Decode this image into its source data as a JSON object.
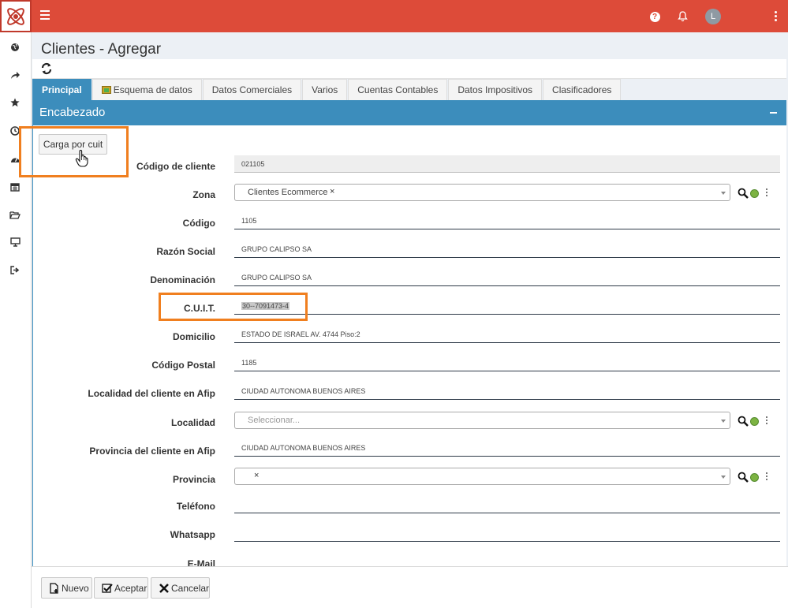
{
  "page": {
    "title": "Clientes - Agregar"
  },
  "tabs": [
    {
      "label": "Principal",
      "active": true
    },
    {
      "label": "Esquema de datos"
    },
    {
      "label": "Datos Comerciales"
    },
    {
      "label": "Varios"
    },
    {
      "label": "Cuentas Contables"
    },
    {
      "label": "Datos Impositivos"
    },
    {
      "label": "Clasificadores"
    }
  ],
  "panel": {
    "title": "Encabezado"
  },
  "actions": {
    "load_by_cuit": "Carga por cuit"
  },
  "form": {
    "codigo_cliente": {
      "label": "Código de cliente",
      "value": "021105"
    },
    "zona": {
      "label": "Zona",
      "value": "Clientes Ecommerce",
      "clear": "×"
    },
    "codigo": {
      "label": "Código",
      "value": "1105"
    },
    "razon_social": {
      "label": "Razón Social",
      "value": "GRUPO CALIPSO SA"
    },
    "denominacion": {
      "label": "Denominación",
      "value": "GRUPO CALIPSO SA"
    },
    "cuit": {
      "label": "C.U.I.T.",
      "value": "30--7091473-4"
    },
    "domicilio": {
      "label": "Domicilio",
      "value": "ESTADO DE ISRAEL AV. 4744 Piso:2"
    },
    "codigo_postal": {
      "label": "Código Postal",
      "value": "1185"
    },
    "localidad_afip": {
      "label": "Localidad del cliente en Afip",
      "value": "CIUDAD AUTONOMA BUENOS AIRES"
    },
    "localidad": {
      "label": "Localidad",
      "placeholder": "Seleccionar..."
    },
    "provincia_afip": {
      "label": "Provincia del cliente en Afip",
      "value": "CIUDAD AUTONOMA BUENOS AIRES"
    },
    "provincia": {
      "label": "Provincia",
      "value": "",
      "clear": "×"
    },
    "telefono": {
      "label": "Teléfono",
      "value": ""
    },
    "whatsapp": {
      "label": "Whatsapp",
      "value": ""
    },
    "email": {
      "label": "E-Mail",
      "value": ""
    }
  },
  "user": {
    "initial": "L"
  },
  "topbar": {
    "help": "?"
  },
  "footer": {
    "nuevo": "Nuevo",
    "aceptar": "Aceptar",
    "cancelar": "Cancelar"
  },
  "colors": {
    "topbar": "#dd4b39",
    "primary": "#3c8dbc",
    "highlight": "#f07f1f"
  }
}
